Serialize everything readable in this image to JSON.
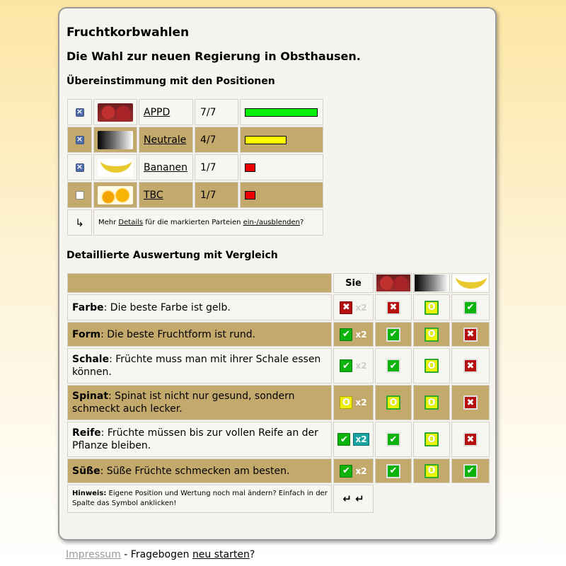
{
  "title": "Fruchtkorbwahlen",
  "subtitle": "Die Wahl zur neuen Regierung in Obsthausen.",
  "section1": "Übereinstimmung mit den Positionen",
  "parties": [
    {
      "name": "APPD",
      "score": "7/7",
      "fraction": 1.0,
      "color": "#00ee00",
      "checked": true
    },
    {
      "name": "Neutrale",
      "score": "4/7",
      "fraction": 0.57,
      "color": "#ffff00",
      "checked": true
    },
    {
      "name": "Bananen",
      "score": "1/7",
      "fraction": 0.14,
      "color": "#ee0000",
      "checked": true
    },
    {
      "name": "TBC",
      "score": "1/7",
      "fraction": 0.14,
      "color": "#ee0000",
      "checked": false
    }
  ],
  "details_row": {
    "arrow": "↳",
    "pre": "Mehr ",
    "details_link": "Details",
    "mid": " für die markierten Parteien ",
    "toggle_link": "ein-/ausblenden",
    "post": "?"
  },
  "section2": "Detaillierte Auswertung mit Vergleich",
  "compare_header": {
    "sie": "Sie"
  },
  "theses": [
    {
      "title": "Farbe",
      "text": ": Die beste Farbe ist gelb.",
      "you": "x",
      "weight": "x2",
      "weighted": false,
      "appd": "x",
      "neutrale": "o",
      "bananen": "check"
    },
    {
      "title": "Form",
      "text": ": Die beste Fruchtform ist rund.",
      "you": "check",
      "weight": "x2",
      "weighted": true,
      "appd": "check",
      "neutrale": "o",
      "bananen": "x"
    },
    {
      "title": "Schale",
      "text": ": Früchte muss man mit ihrer Schale essen können.",
      "you": "check",
      "weight": "x2",
      "weighted": false,
      "appd": "check",
      "neutrale": "o",
      "bananen": "x"
    },
    {
      "title": "Spinat",
      "text": ": Spinat ist nicht nur gesund, sondern schmeckt auch lecker.",
      "you": "o",
      "weight": "x2",
      "weighted": true,
      "appd": "o",
      "neutrale": "o",
      "bananen": "x"
    },
    {
      "title": "Reife",
      "text": ": Früchte müssen bis zur vollen Reife an der Pflanze bleiben.",
      "you": "check",
      "weight": "x2",
      "weighted": true,
      "appd": "check",
      "neutrale": "o",
      "bananen": "x"
    },
    {
      "title": "Süße",
      "text": ": Süße Früchte schmecken am besten.",
      "you": "check",
      "weight": "x2",
      "weighted": true,
      "appd": "check",
      "neutrale": "o",
      "bananen": "check"
    }
  ],
  "hint": {
    "label": "Hinweis:",
    "text": " Eigene Position und Wertung noch mal ändern? Einfach in der Spalte das Symbol anklicken!",
    "arrows": "↵ ↵"
  },
  "footer": {
    "impressum": "Impressum",
    "mid": " - Fragebogen ",
    "restart": "neu starten",
    "post": "?"
  },
  "icons": {
    "check": "✔",
    "x": "✖",
    "o": "O"
  },
  "colors": {
    "tan": "#c4a96d",
    "check": "#0cb30c",
    "cross": "#b40e0e",
    "neutral": "#f0f000"
  }
}
